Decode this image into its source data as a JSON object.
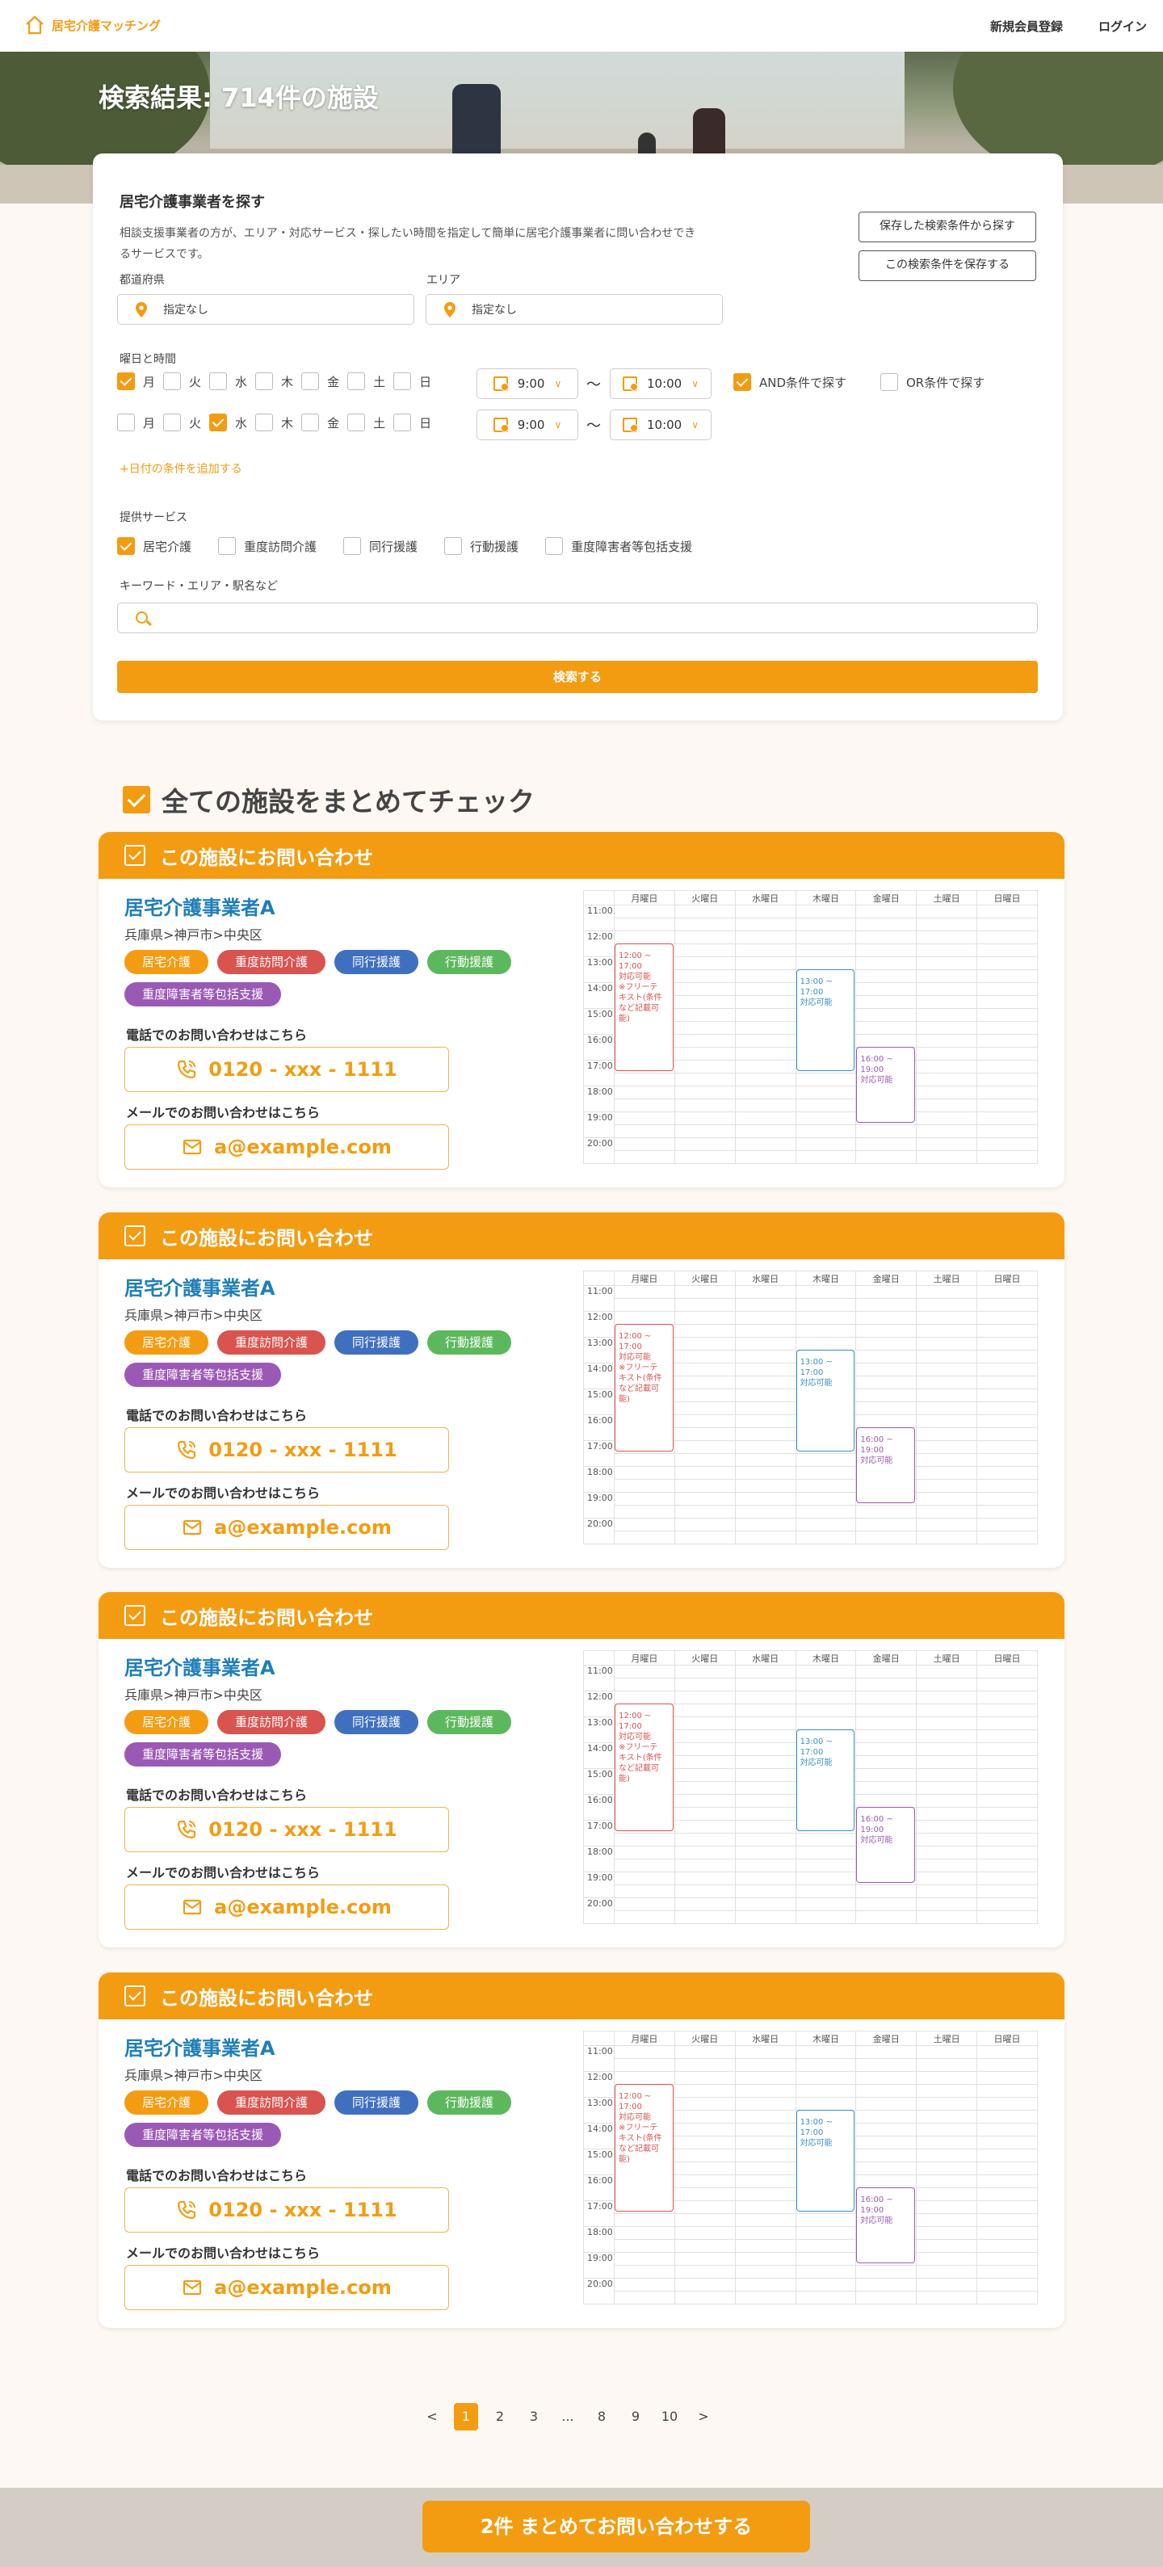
{
  "header": {
    "logo_text": "居宅介護マッチング",
    "nav": [
      "新規会員登録",
      "ログイン"
    ]
  },
  "hero": {
    "title": "検索結果: 714件の施設"
  },
  "search": {
    "title": "居宅介護事業者を探す",
    "description": "相談支援事業者の方が、エリア・対応サービス・探したい時間を指定して簡単に居宅介護事業者に問い合わせできるサービスです。",
    "saved_button": "保存した検索条件から探す",
    "save_button": "この検索条件を保存する",
    "prefecture_label": "都道府県",
    "prefecture_value": "指定なし",
    "area_label": "エリア",
    "area_value": "指定なし",
    "datetime_label": "曜日と時間",
    "days": [
      "月",
      "火",
      "水",
      "木",
      "金",
      "土",
      "日"
    ],
    "row1": {
      "checked": [
        true,
        false,
        false,
        false,
        false,
        false,
        false
      ],
      "start": "9:00",
      "end": "10:00"
    },
    "row2": {
      "checked": [
        false,
        false,
        true,
        false,
        false,
        false,
        false
      ],
      "start": "9:00",
      "end": "10:00"
    },
    "tilde": "〜",
    "and_label": "AND条件で探す",
    "or_label": "OR条件で探す",
    "add_date": "+日付の条件を追加する",
    "services_label": "提供サービス",
    "services": [
      {
        "label": "居宅介護",
        "checked": true
      },
      {
        "label": "重度訪問介護",
        "checked": false
      },
      {
        "label": "同行援護",
        "checked": false
      },
      {
        "label": "行動援護",
        "checked": false
      },
      {
        "label": "重度障害者等包括支援",
        "checked": false
      }
    ],
    "keyword_label": "キーワード・エリア・駅名など",
    "keyword_placeholder": "",
    "search_button": "検索する"
  },
  "check_all": "全ての施設をまとめてチェック",
  "facility_common": {
    "header": "この施設にお問い合わせ",
    "name": "居宅介護事業者A",
    "address": "兵庫県>神戸市>中央区",
    "tags": [
      {
        "label": "居宅介護",
        "color": "#f39c12"
      },
      {
        "label": "重度訪問介護",
        "color": "#d9534f"
      },
      {
        "label": "同行援護",
        "color": "#3f6fbf"
      },
      {
        "label": "行動援護",
        "color": "#5cb85c"
      },
      {
        "label": "重度障害者等包括支援",
        "color": "#9b59b6"
      }
    ],
    "phone_label": "電話でのお問い合わせはこちら",
    "phone": "0120 - xxx - 1111",
    "mail_label": "メールでのお問い合わせはこちら",
    "mail": "a@example.com",
    "schedule": {
      "days": [
        "月曜日",
        "火曜日",
        "水曜日",
        "木曜日",
        "金曜日",
        "土曜日",
        "日曜日"
      ],
      "hours": [
        "11:00",
        "12:00",
        "13:00",
        "14:00",
        "15:00",
        "16:00",
        "17:00",
        "18:00",
        "19:00",
        "20:00"
      ],
      "slots": [
        {
          "day": "月曜日",
          "text": "12:00 ~\n17:00\n対応可能\n※フリーテ\nキスト(条件\nなど記載可\n能)",
          "color": "#d9534f"
        },
        {
          "day": "木曜日",
          "text": "13:00 ~\n17:00\n対応可能",
          "color": "#3a8fc4"
        },
        {
          "day": "金曜日",
          "text": "16:00 ~\n19:00\n対応可能",
          "color": "#9b59b6"
        }
      ]
    }
  },
  "facility_count": 4,
  "pagination": {
    "prev": "<",
    "pages": [
      "1",
      "2",
      "3",
      "...",
      "8",
      "9",
      "10"
    ],
    "current": "1",
    "next": ">"
  },
  "bulk_button": "2件 まとめてお問い合わせする"
}
